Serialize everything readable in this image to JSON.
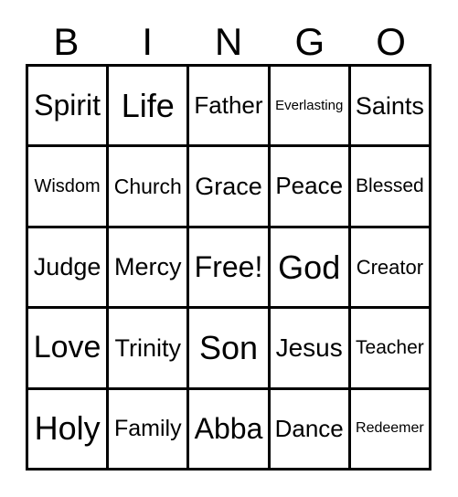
{
  "card": {
    "type": "bingo-card",
    "columns": 5,
    "rows": 5,
    "text_color": "#000000",
    "background_color": "#ffffff",
    "border_color": "#000000"
  },
  "header": {
    "letters": [
      {
        "label": "B"
      },
      {
        "label": "I"
      },
      {
        "label": "N"
      },
      {
        "label": "G"
      },
      {
        "label": "O"
      }
    ]
  },
  "grid": {
    "cells": [
      {
        "label": "Spirit",
        "row": 1,
        "col": 1,
        "column_letter": "B",
        "size": "fs-lg",
        "free_space": false
      },
      {
        "label": "Life",
        "row": 1,
        "col": 2,
        "column_letter": "I",
        "size": "fs-xl",
        "free_space": false
      },
      {
        "label": "Father",
        "row": 1,
        "col": 3,
        "column_letter": "N",
        "size": "fs-md",
        "free_space": false
      },
      {
        "label": "Everlasting",
        "row": 1,
        "col": 4,
        "column_letter": "G",
        "size": "fs-xxs",
        "free_space": false
      },
      {
        "label": "Saints",
        "row": 1,
        "col": 5,
        "column_letter": "O",
        "size": "fs-md",
        "free_space": false
      },
      {
        "label": "Wisdom",
        "row": 2,
        "col": 1,
        "column_letter": "B",
        "size": "fs-sm",
        "free_space": false
      },
      {
        "label": "Church",
        "row": 2,
        "col": 2,
        "column_letter": "I",
        "size": "fs-md",
        "free_space": false
      },
      {
        "label": "Grace",
        "row": 2,
        "col": 3,
        "column_letter": "N",
        "size": "fs-lg",
        "free_space": false
      },
      {
        "label": "Peace",
        "row": 2,
        "col": 4,
        "column_letter": "G",
        "size": "fs-lg",
        "free_space": false
      },
      {
        "label": "Blessed",
        "row": 2,
        "col": 5,
        "column_letter": "O",
        "size": "fs-sm",
        "free_space": false
      },
      {
        "label": "Judge",
        "row": 3,
        "col": 1,
        "column_letter": "B",
        "size": "fs-md",
        "free_space": false
      },
      {
        "label": "Mercy",
        "row": 3,
        "col": 2,
        "column_letter": "I",
        "size": "fs-md",
        "free_space": false
      },
      {
        "label": "Free!",
        "row": 3,
        "col": 3,
        "column_letter": "N",
        "size": "fs-lg",
        "free_space": true
      },
      {
        "label": "God",
        "row": 3,
        "col": 4,
        "column_letter": "G",
        "size": "fs-xl",
        "free_space": false
      },
      {
        "label": "Creator",
        "row": 3,
        "col": 5,
        "column_letter": "O",
        "size": "fs-sm",
        "free_space": false
      },
      {
        "label": "Love",
        "row": 4,
        "col": 1,
        "column_letter": "B",
        "size": "fs-xl",
        "free_space": false
      },
      {
        "label": "Trinity",
        "row": 4,
        "col": 2,
        "column_letter": "I",
        "size": "fs-md",
        "free_space": false
      },
      {
        "label": "Son",
        "row": 4,
        "col": 3,
        "column_letter": "N",
        "size": "fs-xl",
        "free_space": false
      },
      {
        "label": "Jesus",
        "row": 4,
        "col": 4,
        "column_letter": "G",
        "size": "fs-lg",
        "free_space": false
      },
      {
        "label": "Teacher",
        "row": 4,
        "col": 5,
        "column_letter": "O",
        "size": "fs-sm",
        "free_space": false
      },
      {
        "label": "Holy",
        "row": 5,
        "col": 1,
        "column_letter": "B",
        "size": "fs-xl",
        "free_space": false
      },
      {
        "label": "Family",
        "row": 5,
        "col": 2,
        "column_letter": "I",
        "size": "fs-md",
        "free_space": false
      },
      {
        "label": "Abba",
        "row": 5,
        "col": 3,
        "column_letter": "N",
        "size": "fs-lg",
        "free_space": false
      },
      {
        "label": "Dance",
        "row": 5,
        "col": 4,
        "column_letter": "G",
        "size": "fs-md",
        "free_space": false
      },
      {
        "label": "Redeemer",
        "row": 5,
        "col": 5,
        "column_letter": "O",
        "size": "fs-xs",
        "free_space": false
      }
    ]
  }
}
